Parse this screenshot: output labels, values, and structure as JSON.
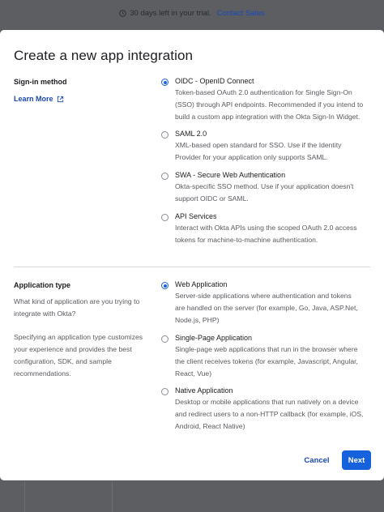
{
  "trial": {
    "message": "30 days left in your trial.",
    "link": "Contact Sales",
    "icon": "clock-icon"
  },
  "modal": {
    "title": "Create a new app integration",
    "sign_in": {
      "label": "Sign-in method",
      "learn_more": "Learn More",
      "learn_more_icon": "external-link-icon",
      "options": [
        {
          "label": "OIDC - OpenID Connect",
          "lines": [
            "Token-based OAuth 2.0 authentication for Single Sign-On",
            "(SSO) through API endpoints. Recommended if you intend to",
            "build a custom app integration with the Okta Sign-In Widget."
          ],
          "selected": true
        },
        {
          "label": "SAML 2.0",
          "lines": [
            "XML-based open standard for SSO. Use if the Identity",
            "Provider for your application only supports SAML."
          ],
          "selected": false
        },
        {
          "label": "SWA - Secure Web Authentication",
          "lines": [
            "Okta-specific SSO method. Use if your application doesn't",
            "support OIDC or SAML."
          ],
          "selected": false
        },
        {
          "label": "API Services",
          "lines": [
            "Interact with Okta APIs using the scoped OAuth 2.0 access",
            "tokens for machine-to-machine authentication."
          ],
          "selected": false
        }
      ]
    },
    "app_type": {
      "label": "Application type",
      "helper1": [
        "What kind of application are you trying to",
        "integrate with Okta?"
      ],
      "helper2": [
        "Specifying an application type customizes",
        "your experience and provides the best",
        "configuration, SDK, and sample",
        "recommendations."
      ],
      "options": [
        {
          "label": "Web Application",
          "lines": [
            "Server-side applications where authentication and tokens",
            "are handled on the server (for example, Go, Java, ASP.Net,",
            "Node.js, PHP)"
          ],
          "selected": true
        },
        {
          "label": "Single-Page Application",
          "lines": [
            "Single-page web applications that run in the browser where",
            "the client receives tokens (for example, Javascript, Angular,",
            "React, Vue)"
          ],
          "selected": false
        },
        {
          "label": "Native Application",
          "lines": [
            "Desktop or mobile applications that run natively on a device",
            "and redirect users to a non-HTTP callback (for example, iOS,",
            "Android, React Native)"
          ],
          "selected": false
        }
      ]
    },
    "buttons": {
      "cancel": "Cancel",
      "next": "Next"
    },
    "colors": {
      "accent": "#1662dd",
      "link": "#1a47b8",
      "overlay": "#5d5e62"
    }
  }
}
